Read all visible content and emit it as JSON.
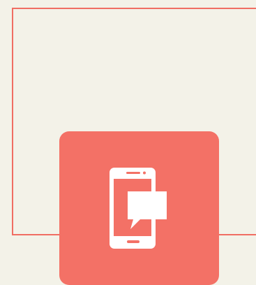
{
  "theme": {
    "background": "#f3f2e8",
    "accent": "#f06e63",
    "tile": "#f37166",
    "icon": "#ffffff"
  },
  "tile": {
    "icon": "smartphone-chat-icon"
  }
}
